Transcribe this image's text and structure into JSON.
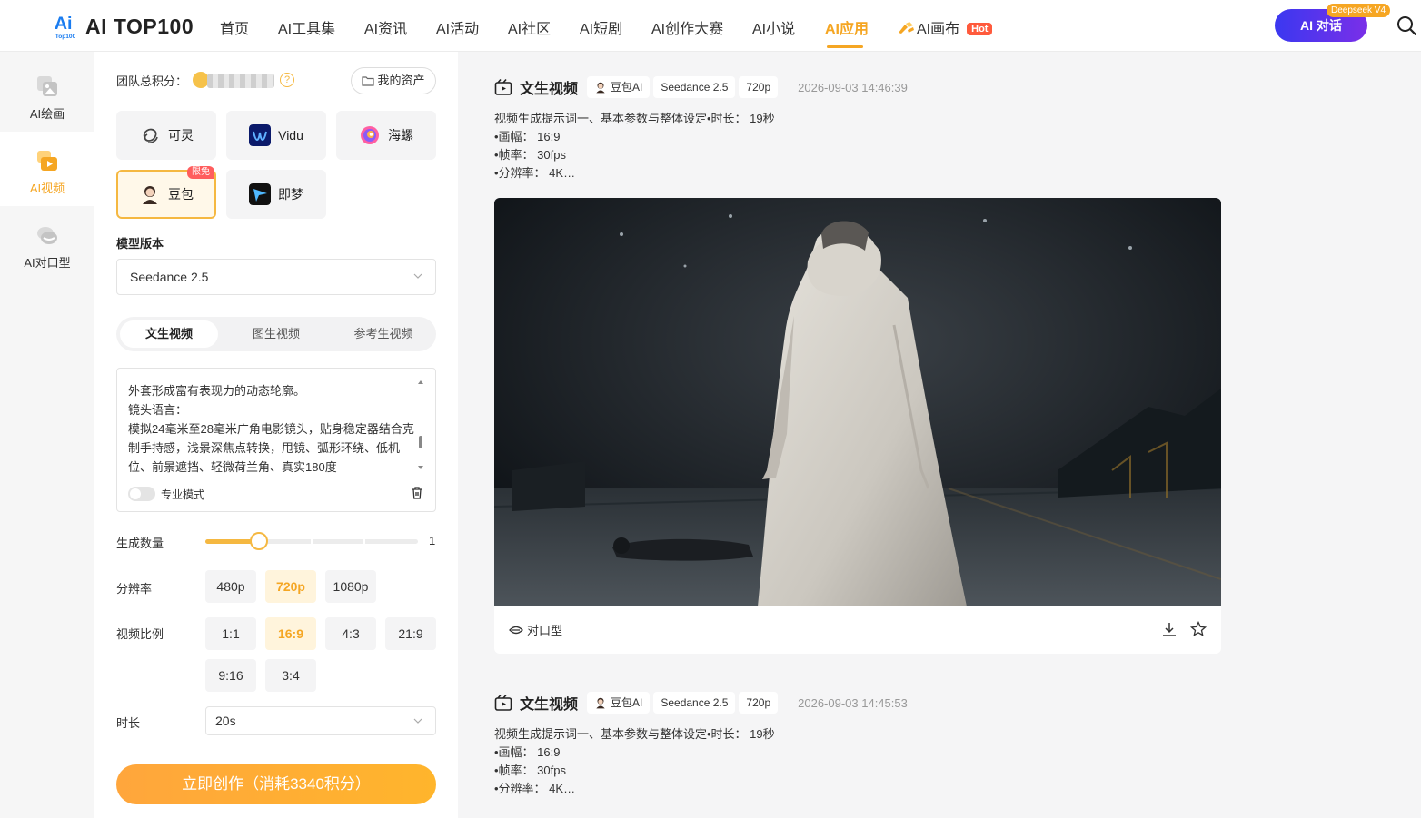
{
  "brand": {
    "name": "AI TOP100",
    "mark": "Ai",
    "mark_sub": "Top100"
  },
  "nav": [
    {
      "label": "首页"
    },
    {
      "label": "AI工具集"
    },
    {
      "label": "AI资讯"
    },
    {
      "label": "AI活动"
    },
    {
      "label": "AI社区"
    },
    {
      "label": "AI短剧"
    },
    {
      "label": "AI创作大赛"
    },
    {
      "label": "AI小说"
    },
    {
      "label": "AI应用",
      "active": true
    },
    {
      "label": "AI画布",
      "badge": "Hot"
    }
  ],
  "chat": {
    "label": "AI 对话",
    "badge": "Deepseek V4"
  },
  "rail": [
    {
      "label": "AI绘画",
      "icon": "image-icon"
    },
    {
      "label": "AI视频",
      "icon": "video-icon",
      "active": true
    },
    {
      "label": "AI对口型",
      "icon": "lips-icon"
    }
  ],
  "panel": {
    "points_label": "团队总积分：",
    "assets_label": "我的资产",
    "models": [
      {
        "label": "可灵",
        "icon": "kling-logo"
      },
      {
        "label": "Vidu",
        "icon": "vidu-logo"
      },
      {
        "label": "海螺",
        "icon": "hailuo-logo"
      },
      {
        "label": "豆包",
        "icon": "doubao-avatar",
        "badge": "限免",
        "selected": true
      },
      {
        "label": "即梦",
        "icon": "jimeng-logo"
      }
    ],
    "model_version_label": "模型版本",
    "model_version_value": "Seedance 2.5",
    "tabs": [
      {
        "label": "文生视频",
        "selected": true
      },
      {
        "label": "图生视频"
      },
      {
        "label": "参考生视频"
      }
    ],
    "prompt_text": "外套形成富有表现力的动态轮廓。\n镜头语言：\n模拟24毫米至28毫米广角电影镜头，贴身稳定器结合克制手持感，浅景深焦点转换，甩镜、弧形环绕、低机位、前景遮挡、轻微荷兰角、真实180度",
    "pro_mode_label": "专业模式",
    "pro_mode_on": false,
    "count_label": "生成数量",
    "count_value": "1",
    "count_fraction": 0.25,
    "resolution_label": "分辨率",
    "resolutions": [
      {
        "label": "480p"
      },
      {
        "label": "720p",
        "selected": true
      },
      {
        "label": "1080p"
      }
    ],
    "ratio_label": "视频比例",
    "ratios": [
      {
        "label": "1:1"
      },
      {
        "label": "16:9",
        "selected": true
      },
      {
        "label": "4:3"
      },
      {
        "label": "21:9"
      },
      {
        "label": "9:16"
      },
      {
        "label": "3:4"
      }
    ],
    "duration_label": "时长",
    "duration_value": "20s",
    "create_label": "立即创作（消耗3340积分）"
  },
  "feed": [
    {
      "title": "文生视频",
      "tags": [
        "豆包AI",
        "Seedance 2.5",
        "720p"
      ],
      "time": "2026-09-03 14:46:39",
      "desc": "视频生成提示词一、基本参数与整体设定•时长： 19秒\n•画幅： 16:9\n•帧率： 30fps\n•分辨率： 4K…",
      "lipsync_label": "对口型"
    },
    {
      "title": "文生视频",
      "tags": [
        "豆包AI",
        "Seedance 2.5",
        "720p"
      ],
      "time": "2026-09-03 14:45:53",
      "desc": "视频生成提示词一、基本参数与整体设定•时长： 19秒\n•画幅： 16:9\n•帧率： 30fps\n•分辨率： 4K…"
    }
  ],
  "colors": {
    "accent": "#f5a623",
    "chat_gradient_start": "#3b38f0",
    "chat_gradient_end": "#7a2fe8",
    "hot": "#ff5a3c"
  }
}
